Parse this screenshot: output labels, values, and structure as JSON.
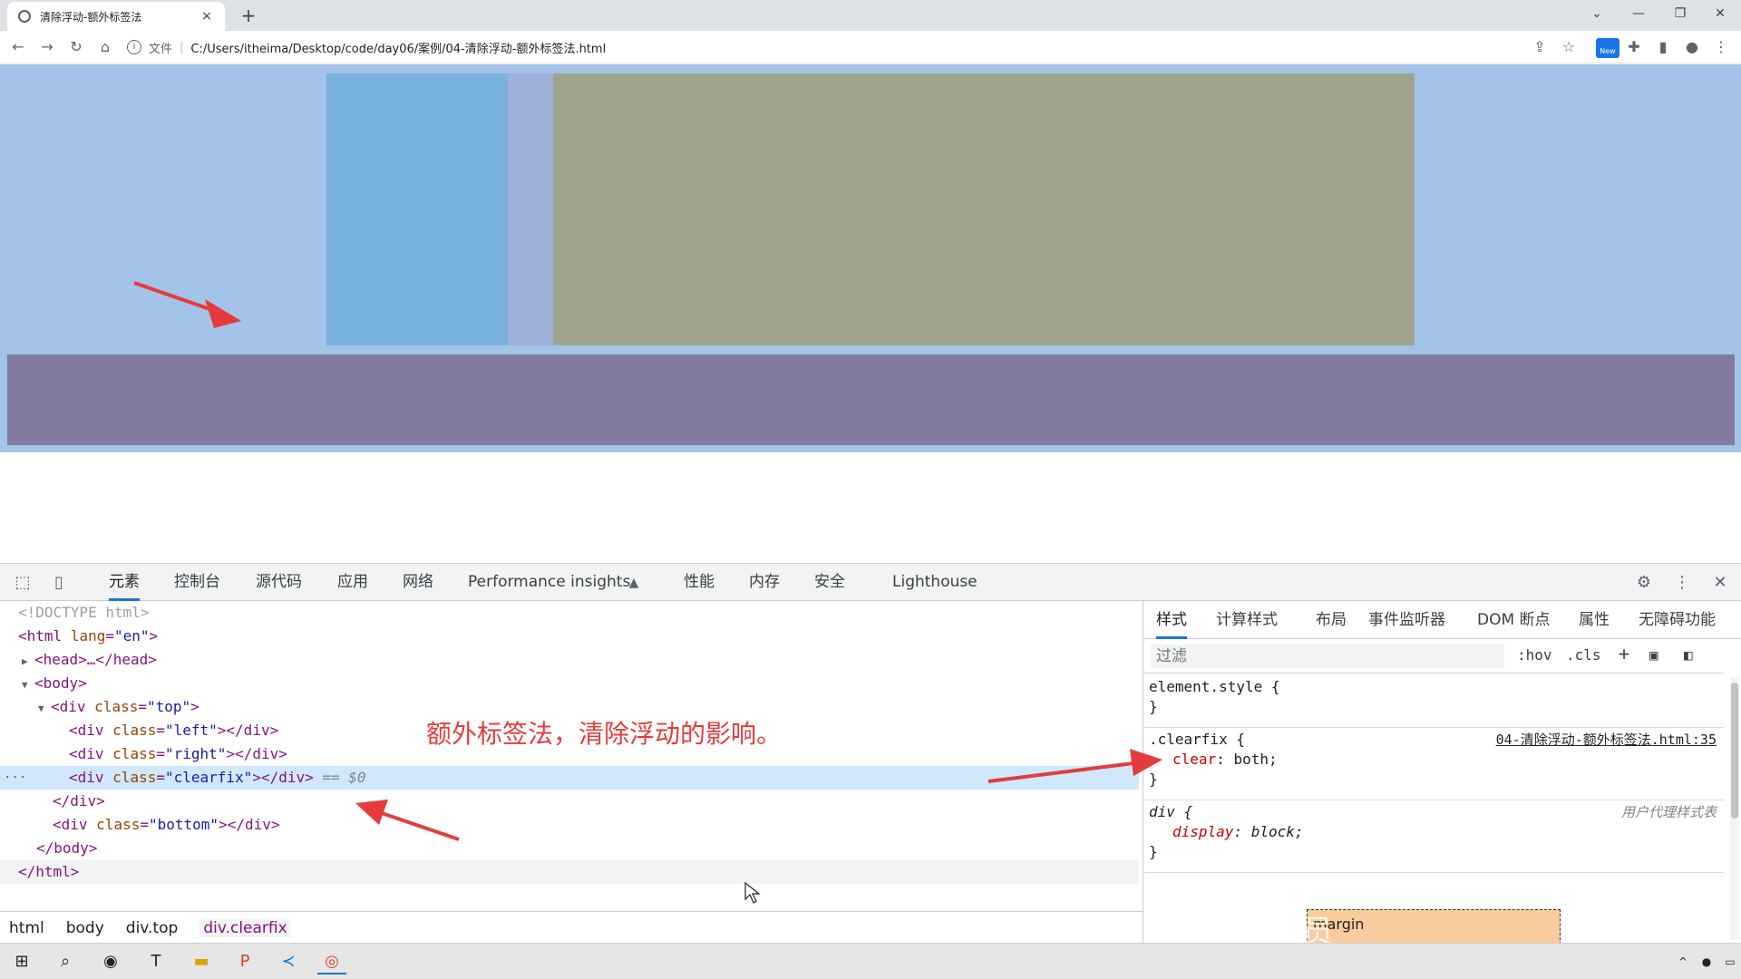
{
  "browser": {
    "tab_title": "清除浮动-额外标签法",
    "tab_close": "×",
    "new_tab": "+",
    "address_scheme": "文件",
    "address_separator": "|",
    "url": "C:/Users/itheima/Desktop/code/day06/案例/04-清除浮动-额外标签法.html",
    "new_badge": "New"
  },
  "devtools": {
    "tabs": [
      "元素",
      "控制台",
      "源代码",
      "应用",
      "网络",
      "Performance insights",
      "性能",
      "内存",
      "安全",
      "Lighthouse"
    ],
    "dom": {
      "doctype": "<!DOCTYPE html>",
      "html_open": "<html",
      "html_attr": "lang",
      "html_val": "\"en\"",
      "head": "<head>…</head>",
      "body_open": "<body>",
      "div_top": {
        "tag": "<div",
        "attr": "class",
        "val": "\"top\"",
        "end": ">"
      },
      "div_left": {
        "tag": "<div",
        "attr": "class",
        "val": "\"left\"",
        "end": "></div>"
      },
      "div_right": {
        "tag": "<div",
        "attr": "class",
        "val": "\"right\"",
        "end": "></div>"
      },
      "div_clearfix": {
        "tag": "<div",
        "attr": "class",
        "val": "\"clearfix\"",
        "end": "></div>",
        "ref": "== $0"
      },
      "div_close": "</div>",
      "div_bottom": {
        "tag": "<div",
        "attr": "class",
        "val": "\"bottom\"",
        "end": "></div>"
      },
      "body_close": "</body>",
      "html_close": "</html>",
      "ellipsis": "···"
    },
    "annotation": "额外标签法，清除浮动的影响。",
    "breadcrumbs": [
      "html",
      "body",
      "div.top",
      "div.clearfix"
    ],
    "styles": {
      "tabs": [
        "样式",
        "计算样式",
        "布局",
        "事件监听器",
        "DOM 断点",
        "属性",
        "无障碍功能"
      ],
      "filter_placeholder": "过滤",
      "hov": ":hov",
      "cls": ".cls",
      "plus": "+",
      "rule1_sel": "element.style {",
      "rule_close": "}",
      "rule2_sel": ".clearfix {",
      "rule2_src": "04-清除浮动-额外标签法.html:35",
      "rule2_prop": "clear",
      "rule2_val": "both;",
      "rule3_sel": "div {",
      "rule3_src": "用户代理样式表",
      "rule3_prop": "display",
      "rule3_val": "block;",
      "box_model_label": "margin"
    }
  },
  "watermark": "黑马程序员",
  "colors": {
    "top_bg": "#a3c3e8",
    "left_box": "#78b2de",
    "right_box": "#9ea48c",
    "bottom_box": "#837aa0",
    "annotation": "#e63b3b",
    "accent": "#1a73e8"
  }
}
